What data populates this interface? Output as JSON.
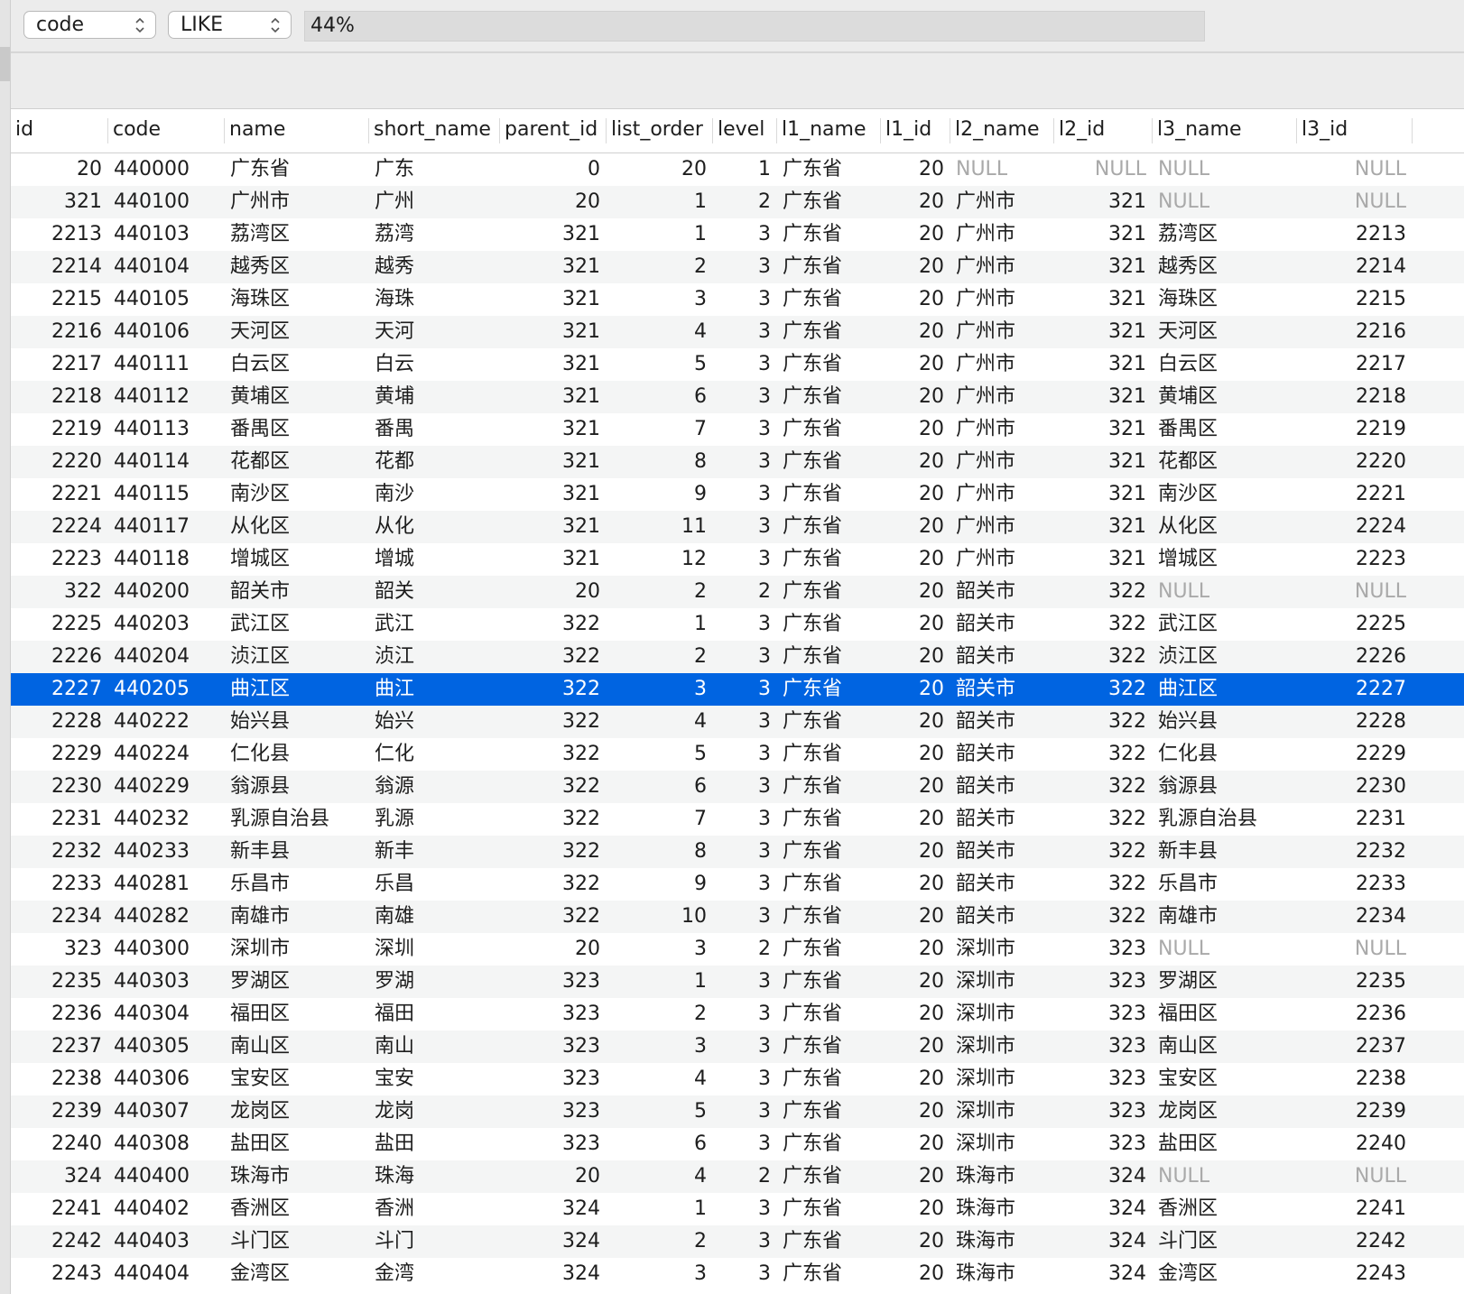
{
  "filter": {
    "field_select": "code",
    "operator_select": "LIKE",
    "value": "44%"
  },
  "columns": [
    "id",
    "code",
    "name",
    "short_name",
    "parent_id",
    "list_order",
    "level",
    "l1_name",
    "l1_id",
    "l2_name",
    "l2_id",
    "l3_name",
    "l3_id"
  ],
  "selected_row_index": 16,
  "rows": [
    [
      "20",
      "440000",
      "广东省",
      "广东",
      "0",
      "20",
      "1",
      "广东省",
      "20",
      "NULL",
      "NULL",
      "NULL",
      "NULL"
    ],
    [
      "321",
      "440100",
      "广州市",
      "广州",
      "20",
      "1",
      "2",
      "广东省",
      "20",
      "广州市",
      "321",
      "NULL",
      "NULL"
    ],
    [
      "2213",
      "440103",
      "荔湾区",
      "荔湾",
      "321",
      "1",
      "3",
      "广东省",
      "20",
      "广州市",
      "321",
      "荔湾区",
      "2213"
    ],
    [
      "2214",
      "440104",
      "越秀区",
      "越秀",
      "321",
      "2",
      "3",
      "广东省",
      "20",
      "广州市",
      "321",
      "越秀区",
      "2214"
    ],
    [
      "2215",
      "440105",
      "海珠区",
      "海珠",
      "321",
      "3",
      "3",
      "广东省",
      "20",
      "广州市",
      "321",
      "海珠区",
      "2215"
    ],
    [
      "2216",
      "440106",
      "天河区",
      "天河",
      "321",
      "4",
      "3",
      "广东省",
      "20",
      "广州市",
      "321",
      "天河区",
      "2216"
    ],
    [
      "2217",
      "440111",
      "白云区",
      "白云",
      "321",
      "5",
      "3",
      "广东省",
      "20",
      "广州市",
      "321",
      "白云区",
      "2217"
    ],
    [
      "2218",
      "440112",
      "黄埔区",
      "黄埔",
      "321",
      "6",
      "3",
      "广东省",
      "20",
      "广州市",
      "321",
      "黄埔区",
      "2218"
    ],
    [
      "2219",
      "440113",
      "番禺区",
      "番禺",
      "321",
      "7",
      "3",
      "广东省",
      "20",
      "广州市",
      "321",
      "番禺区",
      "2219"
    ],
    [
      "2220",
      "440114",
      "花都区",
      "花都",
      "321",
      "8",
      "3",
      "广东省",
      "20",
      "广州市",
      "321",
      "花都区",
      "2220"
    ],
    [
      "2221",
      "440115",
      "南沙区",
      "南沙",
      "321",
      "9",
      "3",
      "广东省",
      "20",
      "广州市",
      "321",
      "南沙区",
      "2221"
    ],
    [
      "2224",
      "440117",
      "从化区",
      "从化",
      "321",
      "11",
      "3",
      "广东省",
      "20",
      "广州市",
      "321",
      "从化区",
      "2224"
    ],
    [
      "2223",
      "440118",
      "增城区",
      "增城",
      "321",
      "12",
      "3",
      "广东省",
      "20",
      "广州市",
      "321",
      "增城区",
      "2223"
    ],
    [
      "322",
      "440200",
      "韶关市",
      "韶关",
      "20",
      "2",
      "2",
      "广东省",
      "20",
      "韶关市",
      "322",
      "NULL",
      "NULL"
    ],
    [
      "2225",
      "440203",
      "武江区",
      "武江",
      "322",
      "1",
      "3",
      "广东省",
      "20",
      "韶关市",
      "322",
      "武江区",
      "2225"
    ],
    [
      "2226",
      "440204",
      "浈江区",
      "浈江",
      "322",
      "2",
      "3",
      "广东省",
      "20",
      "韶关市",
      "322",
      "浈江区",
      "2226"
    ],
    [
      "2227",
      "440205",
      "曲江区",
      "曲江",
      "322",
      "3",
      "3",
      "广东省",
      "20",
      "韶关市",
      "322",
      "曲江区",
      "2227"
    ],
    [
      "2228",
      "440222",
      "始兴县",
      "始兴",
      "322",
      "4",
      "3",
      "广东省",
      "20",
      "韶关市",
      "322",
      "始兴县",
      "2228"
    ],
    [
      "2229",
      "440224",
      "仁化县",
      "仁化",
      "322",
      "5",
      "3",
      "广东省",
      "20",
      "韶关市",
      "322",
      "仁化县",
      "2229"
    ],
    [
      "2230",
      "440229",
      "翁源县",
      "翁源",
      "322",
      "6",
      "3",
      "广东省",
      "20",
      "韶关市",
      "322",
      "翁源县",
      "2230"
    ],
    [
      "2231",
      "440232",
      "乳源自治县",
      "乳源",
      "322",
      "7",
      "3",
      "广东省",
      "20",
      "韶关市",
      "322",
      "乳源自治县",
      "2231"
    ],
    [
      "2232",
      "440233",
      "新丰县",
      "新丰",
      "322",
      "8",
      "3",
      "广东省",
      "20",
      "韶关市",
      "322",
      "新丰县",
      "2232"
    ],
    [
      "2233",
      "440281",
      "乐昌市",
      "乐昌",
      "322",
      "9",
      "3",
      "广东省",
      "20",
      "韶关市",
      "322",
      "乐昌市",
      "2233"
    ],
    [
      "2234",
      "440282",
      "南雄市",
      "南雄",
      "322",
      "10",
      "3",
      "广东省",
      "20",
      "韶关市",
      "322",
      "南雄市",
      "2234"
    ],
    [
      "323",
      "440300",
      "深圳市",
      "深圳",
      "20",
      "3",
      "2",
      "广东省",
      "20",
      "深圳市",
      "323",
      "NULL",
      "NULL"
    ],
    [
      "2235",
      "440303",
      "罗湖区",
      "罗湖",
      "323",
      "1",
      "3",
      "广东省",
      "20",
      "深圳市",
      "323",
      "罗湖区",
      "2235"
    ],
    [
      "2236",
      "440304",
      "福田区",
      "福田",
      "323",
      "2",
      "3",
      "广东省",
      "20",
      "深圳市",
      "323",
      "福田区",
      "2236"
    ],
    [
      "2237",
      "440305",
      "南山区",
      "南山",
      "323",
      "3",
      "3",
      "广东省",
      "20",
      "深圳市",
      "323",
      "南山区",
      "2237"
    ],
    [
      "2238",
      "440306",
      "宝安区",
      "宝安",
      "323",
      "4",
      "3",
      "广东省",
      "20",
      "深圳市",
      "323",
      "宝安区",
      "2238"
    ],
    [
      "2239",
      "440307",
      "龙岗区",
      "龙岗",
      "323",
      "5",
      "3",
      "广东省",
      "20",
      "深圳市",
      "323",
      "龙岗区",
      "2239"
    ],
    [
      "2240",
      "440308",
      "盐田区",
      "盐田",
      "323",
      "6",
      "3",
      "广东省",
      "20",
      "深圳市",
      "323",
      "盐田区",
      "2240"
    ],
    [
      "324",
      "440400",
      "珠海市",
      "珠海",
      "20",
      "4",
      "2",
      "广东省",
      "20",
      "珠海市",
      "324",
      "NULL",
      "NULL"
    ],
    [
      "2241",
      "440402",
      "香洲区",
      "香洲",
      "324",
      "1",
      "3",
      "广东省",
      "20",
      "珠海市",
      "324",
      "香洲区",
      "2241"
    ],
    [
      "2242",
      "440403",
      "斗门区",
      "斗门",
      "324",
      "2",
      "3",
      "广东省",
      "20",
      "珠海市",
      "324",
      "斗门区",
      "2242"
    ],
    [
      "2243",
      "440404",
      "金湾区",
      "金湾",
      "324",
      "3",
      "3",
      "广东省",
      "20",
      "珠海市",
      "324",
      "金湾区",
      "2243"
    ]
  ]
}
